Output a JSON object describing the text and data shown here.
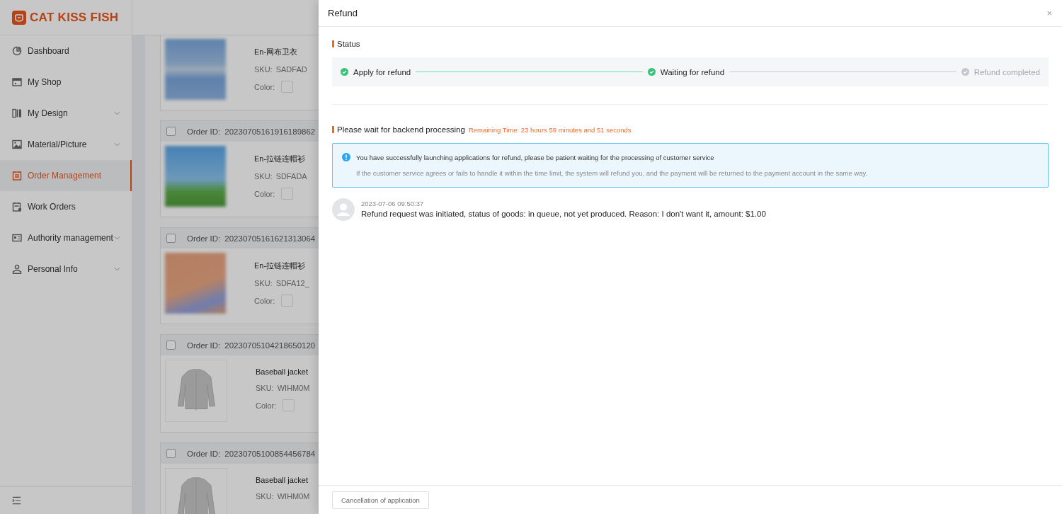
{
  "sidebar": {
    "logo": "CAT KISS FISH",
    "items": [
      {
        "kind": "dashboard",
        "label": "Dashboard",
        "selected": false,
        "expandable": false
      },
      {
        "kind": "shop",
        "label": "My Shop",
        "selected": false,
        "expandable": false
      },
      {
        "kind": "design",
        "label": "My Design",
        "selected": false,
        "expandable": true
      },
      {
        "kind": "picture",
        "label": "Material/Picture",
        "selected": false,
        "expandable": true
      },
      {
        "kind": "order",
        "label": "Order Management",
        "selected": true,
        "expandable": false
      },
      {
        "kind": "work",
        "label": "Work Orders",
        "selected": false,
        "expandable": false
      },
      {
        "kind": "authority",
        "label": "Authority management",
        "selected": false,
        "expandable": true
      },
      {
        "kind": "person",
        "label": "Personal Info",
        "selected": false,
        "expandable": true
      }
    ]
  },
  "orders": [
    {
      "kind": "photo",
      "title": "En-网布卫衣",
      "sku_label": "SKU:",
      "sku": "SADFAD",
      "color_label": "Color:"
    },
    {
      "kind": "photo",
      "checked": false,
      "order_label": "Order ID:",
      "order_id": "20230705161916189862",
      "title": "En-拉链连帽衫",
      "sku_label": "SKU:",
      "sku": "SDFADA",
      "color_label": "Color:"
    },
    {
      "kind": "photo",
      "checked": false,
      "order_label": "Order ID:",
      "order_id": "20230705161621313064",
      "title": "En-拉链连帽衫",
      "sku_label": "SKU:",
      "sku": "SDFA12_",
      "color_label": "Color:"
    },
    {
      "kind": "jacket",
      "checked": false,
      "order_label": "Order ID:",
      "order_id": "20230705104218650120",
      "title": "Baseball jacket",
      "sku_label": "SKU:",
      "sku": "WIHM0M",
      "color_label": "Color:"
    },
    {
      "kind": "jacket",
      "checked": false,
      "order_label": "Order ID:",
      "order_id": "20230705100854456784",
      "title": "Baseball jacket",
      "sku_label": "SKU:",
      "sku": "WIHM0M"
    }
  ],
  "drawer": {
    "title": "Refund",
    "close": "×",
    "status_title": "Status",
    "steps": [
      {
        "label": "Apply for refund",
        "done": true
      },
      {
        "label": "Waiting for refund",
        "done": true
      },
      {
        "label": "Refund completed",
        "done": false
      }
    ],
    "processing_title": "Please wait for backend processing",
    "remaining_time": "Remaining Time: 23 hours 59 minutes and 51 seconds",
    "notice": {
      "message": "You have successfully launching applications for refund, please be patient waiting for the processing of customer service",
      "detail": "If the customer service agrees or fails to handle it within the time limit, the system will refund you, and the payment will be returned to the payment account in the same way."
    },
    "logs": [
      {
        "time": "2023-07-06 09:50:37",
        "text": "Refund request was initiated, status of goods: in queue, not yet produced. Reason: I don't want it, amount: $1.00"
      }
    ],
    "footer_button": "Cancellation of application"
  }
}
